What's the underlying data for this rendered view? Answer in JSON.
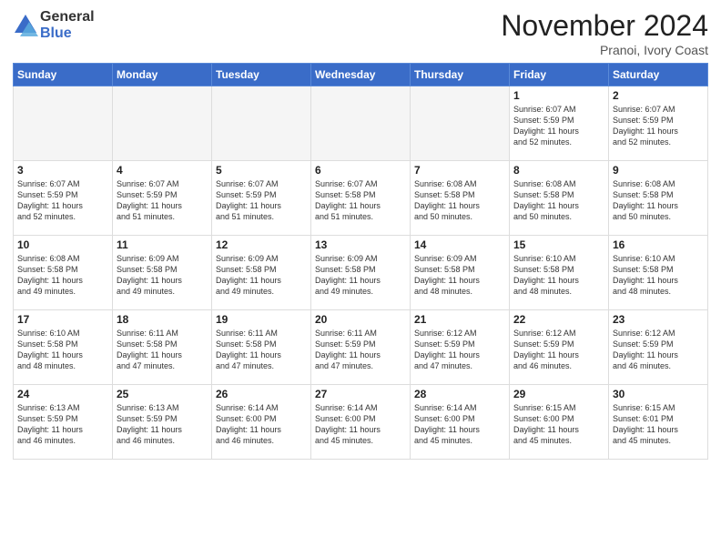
{
  "logo": {
    "general": "General",
    "blue": "Blue"
  },
  "title": "November 2024",
  "subtitle": "Pranoi, Ivory Coast",
  "weekdays": [
    "Sunday",
    "Monday",
    "Tuesday",
    "Wednesday",
    "Thursday",
    "Friday",
    "Saturday"
  ],
  "weeks": [
    [
      {
        "day": "",
        "empty": true
      },
      {
        "day": "",
        "empty": true
      },
      {
        "day": "",
        "empty": true
      },
      {
        "day": "",
        "empty": true
      },
      {
        "day": "",
        "empty": true
      },
      {
        "day": "1",
        "info": "Sunrise: 6:07 AM\nSunset: 5:59 PM\nDaylight: 11 hours\nand 52 minutes."
      },
      {
        "day": "2",
        "info": "Sunrise: 6:07 AM\nSunset: 5:59 PM\nDaylight: 11 hours\nand 52 minutes."
      }
    ],
    [
      {
        "day": "3",
        "info": "Sunrise: 6:07 AM\nSunset: 5:59 PM\nDaylight: 11 hours\nand 52 minutes."
      },
      {
        "day": "4",
        "info": "Sunrise: 6:07 AM\nSunset: 5:59 PM\nDaylight: 11 hours\nand 51 minutes."
      },
      {
        "day": "5",
        "info": "Sunrise: 6:07 AM\nSunset: 5:59 PM\nDaylight: 11 hours\nand 51 minutes."
      },
      {
        "day": "6",
        "info": "Sunrise: 6:07 AM\nSunset: 5:58 PM\nDaylight: 11 hours\nand 51 minutes."
      },
      {
        "day": "7",
        "info": "Sunrise: 6:08 AM\nSunset: 5:58 PM\nDaylight: 11 hours\nand 50 minutes."
      },
      {
        "day": "8",
        "info": "Sunrise: 6:08 AM\nSunset: 5:58 PM\nDaylight: 11 hours\nand 50 minutes."
      },
      {
        "day": "9",
        "info": "Sunrise: 6:08 AM\nSunset: 5:58 PM\nDaylight: 11 hours\nand 50 minutes."
      }
    ],
    [
      {
        "day": "10",
        "info": "Sunrise: 6:08 AM\nSunset: 5:58 PM\nDaylight: 11 hours\nand 49 minutes."
      },
      {
        "day": "11",
        "info": "Sunrise: 6:09 AM\nSunset: 5:58 PM\nDaylight: 11 hours\nand 49 minutes."
      },
      {
        "day": "12",
        "info": "Sunrise: 6:09 AM\nSunset: 5:58 PM\nDaylight: 11 hours\nand 49 minutes."
      },
      {
        "day": "13",
        "info": "Sunrise: 6:09 AM\nSunset: 5:58 PM\nDaylight: 11 hours\nand 49 minutes."
      },
      {
        "day": "14",
        "info": "Sunrise: 6:09 AM\nSunset: 5:58 PM\nDaylight: 11 hours\nand 48 minutes."
      },
      {
        "day": "15",
        "info": "Sunrise: 6:10 AM\nSunset: 5:58 PM\nDaylight: 11 hours\nand 48 minutes."
      },
      {
        "day": "16",
        "info": "Sunrise: 6:10 AM\nSunset: 5:58 PM\nDaylight: 11 hours\nand 48 minutes."
      }
    ],
    [
      {
        "day": "17",
        "info": "Sunrise: 6:10 AM\nSunset: 5:58 PM\nDaylight: 11 hours\nand 48 minutes."
      },
      {
        "day": "18",
        "info": "Sunrise: 6:11 AM\nSunset: 5:58 PM\nDaylight: 11 hours\nand 47 minutes."
      },
      {
        "day": "19",
        "info": "Sunrise: 6:11 AM\nSunset: 5:58 PM\nDaylight: 11 hours\nand 47 minutes."
      },
      {
        "day": "20",
        "info": "Sunrise: 6:11 AM\nSunset: 5:59 PM\nDaylight: 11 hours\nand 47 minutes."
      },
      {
        "day": "21",
        "info": "Sunrise: 6:12 AM\nSunset: 5:59 PM\nDaylight: 11 hours\nand 47 minutes."
      },
      {
        "day": "22",
        "info": "Sunrise: 6:12 AM\nSunset: 5:59 PM\nDaylight: 11 hours\nand 46 minutes."
      },
      {
        "day": "23",
        "info": "Sunrise: 6:12 AM\nSunset: 5:59 PM\nDaylight: 11 hours\nand 46 minutes."
      }
    ],
    [
      {
        "day": "24",
        "info": "Sunrise: 6:13 AM\nSunset: 5:59 PM\nDaylight: 11 hours\nand 46 minutes."
      },
      {
        "day": "25",
        "info": "Sunrise: 6:13 AM\nSunset: 5:59 PM\nDaylight: 11 hours\nand 46 minutes."
      },
      {
        "day": "26",
        "info": "Sunrise: 6:14 AM\nSunset: 6:00 PM\nDaylight: 11 hours\nand 46 minutes."
      },
      {
        "day": "27",
        "info": "Sunrise: 6:14 AM\nSunset: 6:00 PM\nDaylight: 11 hours\nand 45 minutes."
      },
      {
        "day": "28",
        "info": "Sunrise: 6:14 AM\nSunset: 6:00 PM\nDaylight: 11 hours\nand 45 minutes."
      },
      {
        "day": "29",
        "info": "Sunrise: 6:15 AM\nSunset: 6:00 PM\nDaylight: 11 hours\nand 45 minutes."
      },
      {
        "day": "30",
        "info": "Sunrise: 6:15 AM\nSunset: 6:01 PM\nDaylight: 11 hours\nand 45 minutes."
      }
    ]
  ]
}
